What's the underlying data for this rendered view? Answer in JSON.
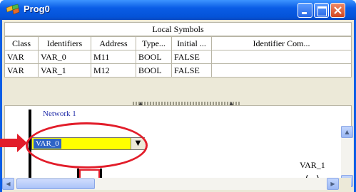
{
  "window": {
    "title": "Prog0"
  },
  "symbols": {
    "section_title": "Local Symbols",
    "columns": [
      "Class",
      "Identifiers",
      "Address",
      "Type...",
      "Initial ...",
      "Identifier Com..."
    ],
    "rows": [
      [
        "VAR",
        "VAR_0",
        "M11",
        "BOOL",
        "FALSE",
        ""
      ],
      [
        "VAR",
        "VAR_1",
        "M12",
        "BOOL",
        "FALSE",
        ""
      ]
    ]
  },
  "network": {
    "title": "Network 1",
    "contact_value": "VAR_0",
    "coil_label": "VAR_1",
    "coil_symbol": "( )"
  },
  "colors": {
    "title_bar": "#0a5de6",
    "contact_highlight": "#ffff00",
    "annotation_red": "#e21d2a"
  }
}
